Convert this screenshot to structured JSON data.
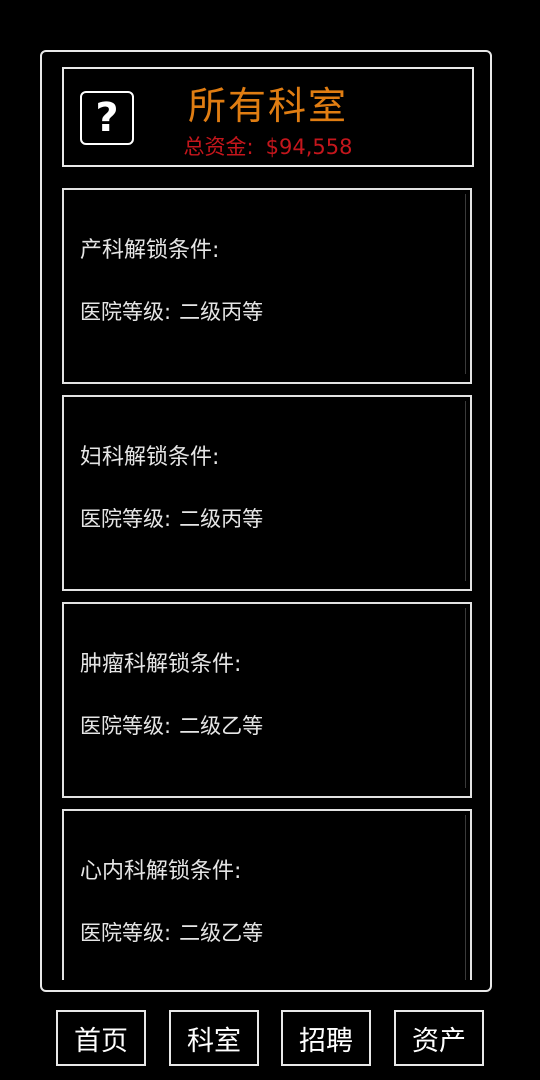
{
  "header": {
    "help_icon": "?",
    "title": "所有科室",
    "funds_label": "总资金:",
    "funds_value": "$94,558"
  },
  "departments": [
    {
      "name": "产科解锁条件:",
      "req_label": "医院等级:",
      "req_value": "二级丙等"
    },
    {
      "name": "妇科解锁条件:",
      "req_label": "医院等级:",
      "req_value": "二级丙等"
    },
    {
      "name": "肿瘤科解锁条件:",
      "req_label": "医院等级:",
      "req_value": "二级乙等"
    },
    {
      "name": "心内科解锁条件:",
      "req_label": "医院等级:",
      "req_value": "二级乙等"
    }
  ],
  "nav": [
    {
      "label": "首页"
    },
    {
      "label": "科室"
    },
    {
      "label": "招聘"
    },
    {
      "label": "资产"
    }
  ],
  "colors": {
    "title": "#e07d12",
    "funds": "#c4161c",
    "border": "#e8e8e8",
    "background": "#000000"
  }
}
